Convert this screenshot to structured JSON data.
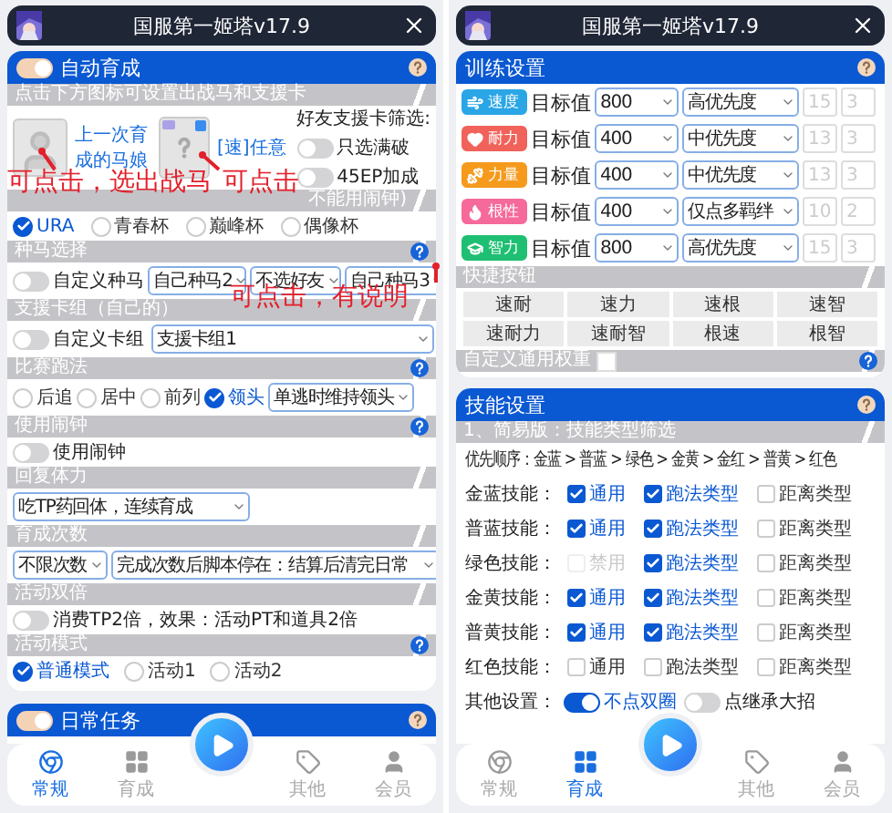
{
  "left_screen": {
    "title": "国服第一姬塔v17.9",
    "auto_header": {
      "label": "自动育成",
      "on": true,
      "help": true
    },
    "pick_hint": "点击下方图标可设置出战马和支援卡",
    "horse": {
      "label": "上一次育成的马娘"
    },
    "card": {
      "label": "[速]任意"
    },
    "friend_filter": {
      "title": "好友支援卡筛选:",
      "toggles": [
        {
          "label": "只选满破",
          "on": false
        },
        {
          "label": "45EP加成",
          "on": false
        }
      ]
    },
    "mode_header": "不能用闹钟)",
    "modes": [
      {
        "label": "URA",
        "selected": true
      },
      {
        "label": "青春杯",
        "selected": false
      },
      {
        "label": "巅峰杯",
        "selected": false
      },
      {
        "label": "偶像杯",
        "selected": false
      }
    ],
    "breed": {
      "header": "种马选择",
      "help": true,
      "toggle": {
        "label": "自定义种马",
        "on": false
      },
      "selects": [
        "自己种马2",
        "不选好友",
        "自己种马3"
      ]
    },
    "deck": {
      "header": "支援卡组（自己的）",
      "toggle": {
        "label": "自定义卡组",
        "on": false
      },
      "select": "支援卡组1"
    },
    "strategy": {
      "header": "比赛跑法",
      "help": true,
      "options": [
        {
          "label": "后追",
          "selected": false
        },
        {
          "label": "居中",
          "selected": false
        },
        {
          "label": "前列",
          "selected": false
        },
        {
          "label": "领头",
          "selected": true
        }
      ],
      "select": "单逃时维持领头"
    },
    "alarm": {
      "header": "使用闹钟",
      "help": true,
      "toggle": {
        "label": "使用闹钟",
        "on": false
      }
    },
    "stamina": {
      "header": "回复体力",
      "select": "吃TP药回体，连续育成"
    },
    "count": {
      "header": "育成次数",
      "selects": [
        "不限次数",
        "完成次数后脚本停在：结算后清完日常"
      ]
    },
    "double": {
      "header": "活动双倍",
      "toggle": {
        "label": "消费TP2倍，效果：活动PT和道具2倍",
        "on": false
      }
    },
    "event": {
      "header": "活动模式",
      "help": true,
      "options": [
        {
          "label": "普通模式",
          "selected": true
        },
        {
          "label": "活动1",
          "selected": false
        },
        {
          "label": "活动2",
          "selected": false
        }
      ]
    },
    "daily": {
      "label": "日常任务",
      "on": true,
      "help": true
    },
    "annotations": [
      "可点击，选出战马",
      "可点击",
      "可点击，有说明"
    ],
    "nav": [
      {
        "label": "常规",
        "kind": "browser",
        "selected": true
      },
      {
        "label": "育成",
        "kind": "grid",
        "selected": false
      },
      {
        "label": "其他",
        "kind": "tag",
        "selected": false
      },
      {
        "label": "会员",
        "kind": "user",
        "selected": false
      }
    ]
  },
  "right_screen": {
    "title": "国服第一姬塔v17.9",
    "training": {
      "header": "训练设置",
      "help": true,
      "rows": [
        {
          "stat": "速度",
          "kind": "speed",
          "color": "#2aa6e6",
          "label": "目标值",
          "target": "800",
          "priority": "高优先度",
          "values": [
            "15",
            "3"
          ]
        },
        {
          "stat": "耐力",
          "kind": "stamina",
          "color": "#f0625a",
          "label": "目标值",
          "target": "400",
          "priority": "中优先度",
          "values": [
            "13",
            "3"
          ]
        },
        {
          "stat": "力量",
          "kind": "power",
          "color": "#f59a1c",
          "label": "目标值",
          "target": "400",
          "priority": "中优先度",
          "values": [
            "13",
            "3"
          ]
        },
        {
          "stat": "根性",
          "kind": "guts",
          "color": "#f56a9a",
          "label": "目标值",
          "target": "400",
          "priority": "仅点多羁绊",
          "values": [
            "10",
            "2"
          ]
        },
        {
          "stat": "智力",
          "kind": "wit",
          "color": "#1fbf73",
          "label": "目标值",
          "target": "800",
          "priority": "高优先度",
          "values": [
            "15",
            "3"
          ]
        }
      ]
    },
    "quick": {
      "header": "快捷按钮",
      "buttons": [
        "速耐",
        "速力",
        "速根",
        "速智",
        "速耐力",
        "速耐智",
        "根速",
        "根智"
      ]
    },
    "weight": {
      "label": "自定义通用权重",
      "checked": false,
      "help": true
    },
    "skills": {
      "header": "技能设置",
      "help": true,
      "subheader": "1、简易版：技能类型筛选",
      "order": "优先顺序：金蓝 > 普蓝 > 绿色 > 金黄 > 金红 > 普黄 > 红色",
      "rows": [
        {
          "label": "金蓝技能：",
          "options": [
            {
              "label": "通用",
              "checked": true,
              "disabled": false
            },
            {
              "label": "跑法类型",
              "checked": true,
              "disabled": false
            },
            {
              "label": "距离类型",
              "checked": false,
              "disabled": false
            }
          ]
        },
        {
          "label": "普蓝技能：",
          "options": [
            {
              "label": "通用",
              "checked": true,
              "disabled": false
            },
            {
              "label": "跑法类型",
              "checked": true,
              "disabled": false
            },
            {
              "label": "距离类型",
              "checked": false,
              "disabled": false
            }
          ]
        },
        {
          "label": "绿色技能：",
          "options": [
            {
              "label": "禁用",
              "checked": false,
              "disabled": true
            },
            {
              "label": "跑法类型",
              "checked": true,
              "disabled": false
            },
            {
              "label": "距离类型",
              "checked": false,
              "disabled": false
            }
          ]
        },
        {
          "label": "金黄技能：",
          "options": [
            {
              "label": "通用",
              "checked": true,
              "disabled": false
            },
            {
              "label": "跑法类型",
              "checked": true,
              "disabled": false
            },
            {
              "label": "距离类型",
              "checked": false,
              "disabled": false
            }
          ]
        },
        {
          "label": "普黄技能：",
          "options": [
            {
              "label": "通用",
              "checked": true,
              "disabled": false
            },
            {
              "label": "跑法类型",
              "checked": true,
              "disabled": false
            },
            {
              "label": "距离类型",
              "checked": false,
              "disabled": false
            }
          ]
        },
        {
          "label": "红色技能：",
          "options": [
            {
              "label": "通用",
              "checked": false,
              "disabled": false
            },
            {
              "label": "跑法类型",
              "checked": false,
              "disabled": false
            },
            {
              "label": "距离类型",
              "checked": false,
              "disabled": false
            }
          ]
        }
      ]
    },
    "other": {
      "label": "其他设置：",
      "toggles": [
        {
          "label": "不点双圈",
          "on": true
        },
        {
          "label": "点继承大招",
          "on": false
        }
      ]
    },
    "nav": [
      {
        "label": "常规",
        "kind": "browser",
        "selected": false
      },
      {
        "label": "育成",
        "kind": "grid",
        "selected": true
      },
      {
        "label": "其他",
        "kind": "tag",
        "selected": false
      },
      {
        "label": "会员",
        "kind": "user",
        "selected": false
      }
    ]
  }
}
